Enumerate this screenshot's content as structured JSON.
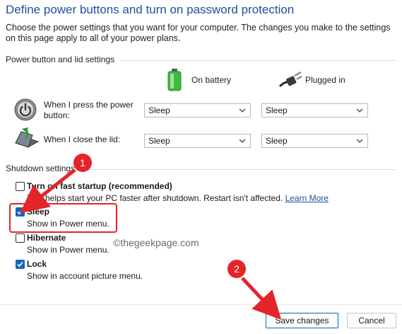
{
  "header": {
    "title": "Define power buttons and turn on password protection",
    "description": "Choose the power settings that you want for your computer. The changes you make to the settings on this page apply to all of your power plans."
  },
  "power_section": {
    "heading": "Power button and lid settings",
    "columns": {
      "battery": "On battery",
      "plugged": "Plugged in"
    },
    "rows": [
      {
        "label": "When I press the power button:",
        "battery_value": "Sleep",
        "plugged_value": "Sleep",
        "icon": "power-button-icon"
      },
      {
        "label": "When I close the lid:",
        "battery_value": "Sleep",
        "plugged_value": "Sleep",
        "icon": "laptop-lid-icon"
      }
    ]
  },
  "shutdown_section": {
    "heading": "Shutdown settings",
    "options": [
      {
        "title": "Turn on fast startup (recommended)",
        "desc": "This helps start your PC faster after shutdown. Restart isn't affected.",
        "link": "Learn More",
        "checked": false
      },
      {
        "title": "Sleep",
        "desc": "Show in Power menu.",
        "checked": true
      },
      {
        "title": "Hibernate",
        "desc": "Show in Power menu.",
        "checked": false
      },
      {
        "title": "Lock",
        "desc": "Show in account picture menu.",
        "checked": true
      }
    ]
  },
  "watermark": "©thegeekpage.com",
  "annotations": {
    "badge1": "1",
    "badge2": "2"
  },
  "footer": {
    "save_label": "Save changes",
    "cancel_label": "Cancel"
  },
  "colors": {
    "accent": "#1565c0",
    "title": "#1f4e9c",
    "annotation": "#e3242b"
  }
}
